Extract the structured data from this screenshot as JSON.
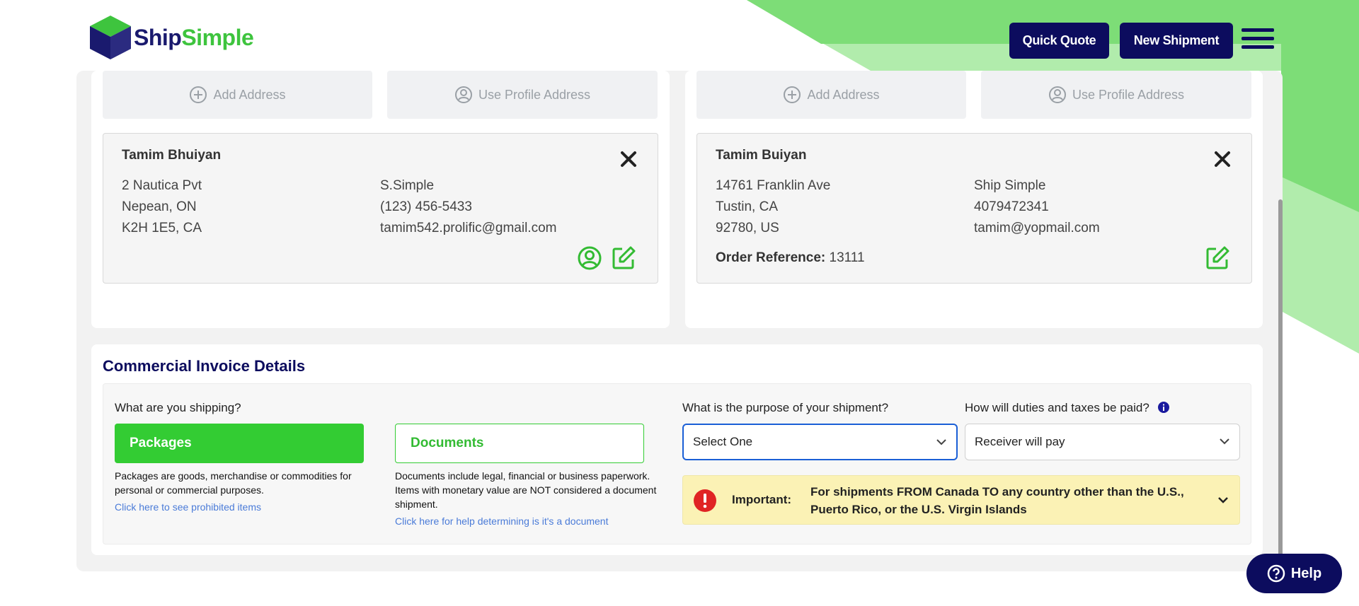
{
  "header": {
    "logo_ship": "Ship",
    "logo_simple": "Simple",
    "quick_quote_label": "Quick Quote",
    "new_shipment_label": "New Shipment"
  },
  "sender": {
    "add_address_label": "Add Address",
    "use_profile_label": "Use Profile Address",
    "name": "Tamim Bhuiyan",
    "street": "2 Nautica Pvt",
    "city": "Nepean, ON",
    "postal": "K2H 1E5, CA",
    "company": "S.Simple",
    "phone": "(123) 456-5433",
    "email": "tamim542.prolific@gmail.com"
  },
  "recipient": {
    "add_address_label": "Add Address",
    "use_profile_label": "Use Profile Address",
    "name": "Tamim Buiyan",
    "street": "14761 Franklin Ave",
    "city": "Tustin, CA",
    "postal": "92780, US",
    "company": "Ship Simple",
    "phone": "4079472341",
    "email": "tamim@yopmail.com",
    "order_ref_label": "Order Reference:",
    "order_ref_value": "13111"
  },
  "commercial_invoice": {
    "title": "Commercial Invoice Details",
    "what_shipping_label": "What are you shipping?",
    "packages_label": "Packages",
    "documents_label": "Documents",
    "packages_desc": "Packages are goods, merchandise or commodities for personal or commercial purposes.",
    "packages_link": "Click here to see prohibited items",
    "documents_desc": "Documents include legal, financial or business paperwork. Items with monetary value are NOT considered a document shipment.",
    "documents_link": "Click here for help determining is it's a document",
    "purpose_label": "What is the purpose of your shipment?",
    "purpose_value": "Select One",
    "duties_label": "How will duties and taxes be paid?",
    "duties_value": "Receiver will pay",
    "important_label": "Important:",
    "important_text": "For shipments FROM Canada TO any country other than the U.S., Puerto Rico, or the U.S. Virgin Islands"
  },
  "help_label": "Help",
  "colors": {
    "brand_navy": "#0c0c5e",
    "brand_green": "#33cc33",
    "link_blue": "#4a7bd8",
    "important_bg": "#fbf2b5",
    "error_red": "#e02424"
  }
}
